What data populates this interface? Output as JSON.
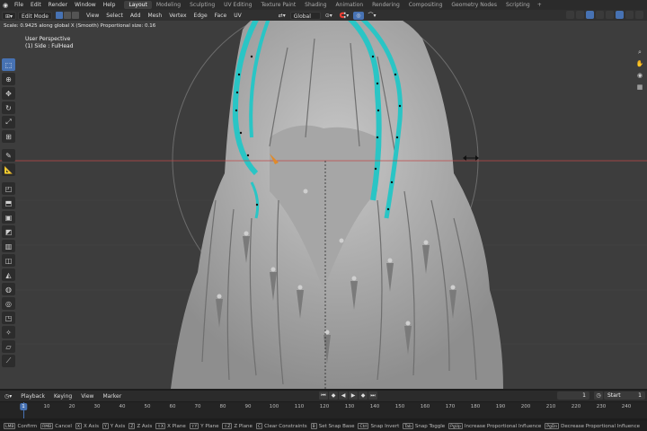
{
  "menubar": {
    "items": [
      "File",
      "Edit",
      "Render",
      "Window",
      "Help"
    ],
    "workspaces": [
      "Layout",
      "Modeling",
      "Sculpting",
      "UV Editing",
      "Texture Paint",
      "Shading",
      "Animation",
      "Rendering",
      "Compositing",
      "Geometry Nodes",
      "Scripting"
    ],
    "active_workspace": "Layout",
    "add_tab": "+"
  },
  "header": {
    "mode": "Edit Mode",
    "menus": [
      "View",
      "Select",
      "Add",
      "Mesh",
      "Vertex",
      "Edge",
      "Face",
      "UV"
    ],
    "orientation": "Global"
  },
  "viewport": {
    "operator_status": "Scale: 0.9425 along global X (Smooth) Proportional size: 0.16",
    "view_name": "User Perspective",
    "object_name": "(1) Side : FulHead",
    "colors": {
      "background": "#3d3d3d",
      "mesh": "#b8b8b8",
      "selection": "#2ac5c5",
      "axis_x": "#c04848"
    }
  },
  "toolbar": {
    "tools": [
      "select-box",
      "cursor",
      "move",
      "rotate",
      "scale",
      "transform",
      "annotate",
      "measure",
      "add-cube",
      "extrude",
      "inset",
      "bevel",
      "loop-cut",
      "knife",
      "poly-build",
      "spin",
      "smooth",
      "edge-slide",
      "shrink-fatten",
      "shear",
      "rip"
    ]
  },
  "timeline": {
    "menus": [
      "Playback",
      "Keying",
      "View",
      "Marker"
    ],
    "current_frame": "1",
    "start_label": "Start",
    "start_value": "1",
    "end_label": "End",
    "ruler": [
      "1",
      "10",
      "20",
      "30",
      "40",
      "50",
      "60",
      "70",
      "80",
      "90",
      "100",
      "110",
      "120",
      "130",
      "140",
      "150",
      "160",
      "170",
      "180",
      "190",
      "200",
      "210",
      "220",
      "230",
      "240"
    ]
  },
  "statusbar": {
    "hints": [
      {
        "key": "LMB",
        "label": "Confirm"
      },
      {
        "key": "RMB",
        "label": "Cancel"
      },
      {
        "key": "X",
        "label": "X Axis"
      },
      {
        "key": "Y",
        "label": "Y Axis"
      },
      {
        "key": "Z",
        "label": "Z Axis"
      },
      {
        "key": "⇧X",
        "label": "X Plane"
      },
      {
        "key": "⇧Y",
        "label": "Y Plane"
      },
      {
        "key": "⇧Z",
        "label": "Z Plane"
      },
      {
        "key": "C",
        "label": "Clear Constraints"
      },
      {
        "key": "B",
        "label": "Set Snap Base"
      },
      {
        "key": "Ctrl",
        "label": "Snap Invert"
      },
      {
        "key": "Tab",
        "label": "Snap Toggle"
      },
      {
        "key": "PgUp",
        "label": "Increase Proportional Influence"
      },
      {
        "key": "PgDn",
        "label": "Decrease Proportional Influence"
      }
    ]
  }
}
